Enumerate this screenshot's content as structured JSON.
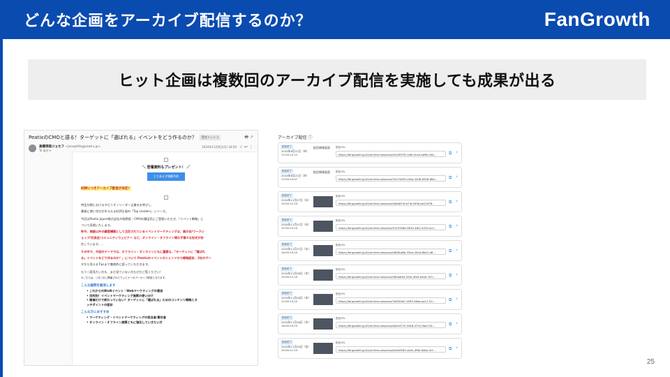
{
  "header": {
    "title": "どんな企画をアーカイブ配信するのか？",
    "logo": "FanGrowth"
  },
  "banner": {
    "text": "ヒット企画は複数回のアーカイブ配信を実施しても成果が出る"
  },
  "page_number": "25",
  "email": {
    "subject": "PeatixのCMOと語る！ターゲットに「選ばれる」イベントをどう作るのか？",
    "tag": "受信トレイ ×",
    "actions": "🖶 ↗",
    "sender_name": "高橋現哉ジョセフ",
    "sender_email": "<josephtk@peatix.jp>",
    "to": "To 自分 ▾",
    "date": "2024年11月8日(月) 18:20",
    "icons": "☆ ↩ ⋮",
    "present": "＼ 登壇資料もプレゼント！ ／",
    "button": "とりあえず視聴予約",
    "highlight": "好評につきアーカイブ配信が決定！",
    "paragraphs": [
      "特定分野におけるオピニオンリーダー企業をお呼びし、",
      "業務に使い学び方を与える好評企画の「Top Leaders」シリーズ。",
      "今回はPeatix Japan株式会社の取締役・CMOの藤田氏にご登壇いただき、「イベント戦略」に",
      "ついて深堀いたします。",
      "昨今、商談以外の顧客構築として注目されているイベントマーケティングは、展示会/ワークシ",
      "ョップ/交流会/コミュニティウェビナー など、オンライン・オフライン問わず様々な形式が存",
      "在しています。…",
      "その中で、今回のテーマでは、オフライン・オンラインともに重要な、「ターゲットに「選ばれ",
      "る」イベントをどう作るのか？」について Peatixのイベントのトレンドから戦略設計、2社のデー",
      "タから見えるTipsまで徹底的に語っていただきます。",
      "もう一度見たい方も、まだ見ていない方もぜひご覧ください！"
    ],
    "note": "※こちらは、○月○日に開催されたウェビナーのアーカイブ配信となります。",
    "sec1": "こんな疑問を解消します",
    "bullets1": [
      "これからのBtoBイベント・Webマーケティングの潮流",
      "目的別！イベントマーケティング施策の使い分け",
      "開催だけで終わっていない？ターゲットに「選ばれる」ためのコンテンツ戦略とタ",
      "ッチポイントの設計"
    ],
    "sec2": "こんな方におすすめ",
    "bullets2": [
      "マーケティング・イベントマーケティングの担当者/責任者",
      "オンライン・オフライン施策ともに強化していきたい方"
    ]
  },
  "archive": {
    "title": "アーカイブ配信 ⓘ",
    "url_label": "配信URL",
    "rows": [
      {
        "badge": "配信終了",
        "date": "2024年8月22日（木）",
        "time": "11:05:12:12",
        "thumb": "配信情報画面",
        "url": "https://fangrowth.jp/v2/archive-sessions/d1e30978-1dfe-4ca4-be6b-44e..."
      },
      {
        "badge": "配信終了",
        "date": "2024年8月22日（木）",
        "time": "13:00:14:07",
        "thumb": "配信情報画面",
        "url": "https://fangrowth.jp/v2/archive-sessions/32e74d20-c9ea-42d6-8348-88e..."
      },
      {
        "badge": "配信終了",
        "date": "2024年11月27日（水）",
        "time": "10:00:11:10",
        "thumb": "",
        "url": "https://fangrowth.jp/v2/archive-sessions/4dba674f-a74f-493b-be21678..."
      },
      {
        "badge": "配信終了",
        "date": "2024年11月27日（水）",
        "time": "12:00:13:10",
        "thumb": "",
        "url": "https://fangrowth.jp/v2/archive-sessions/5103308d-9630-4fb1-b334-ec1..."
      },
      {
        "badge": "配信終了",
        "date": "2024年11月27日（水）",
        "time": "16:00:19:10",
        "thumb": "",
        "url": "https://fangrowth.jp/v2/archive-sessions/a608ca8b-33ea-40d4-8b42-d6..."
      },
      {
        "badge": "配信終了",
        "date": "2024年11月28日（木）",
        "time": "10:00:11:10",
        "thumb": "",
        "url": "https://fangrowth.jp/v2/archive-sessions/080aafa5-03f4-4fa9-b44d-7d3..."
      },
      {
        "badge": "配信終了",
        "date": "2024年11月28日（木）",
        "time": "12:00:13:10",
        "thumb": "",
        "url": "https://fangrowth.jp/v2/archive-sessions/7b55f4d2-1693-48da-aa17-20..."
      },
      {
        "badge": "配信終了",
        "date": "2024年11月28日（木）",
        "time": "16:00:19:10",
        "thumb": "",
        "url": "https://fangrowth.jp/v2/archive-sessions/da2e4715-58c8-47c0-9aa7-81..."
      },
      {
        "badge": "配信終了",
        "date": "2024年11月29日（金）",
        "time": "10:00:11:10",
        "thumb": "",
        "url": "https://fangrowth.jp/v2/archive-sessions/b2ba9583-cbd1-4f6e-84be-5cf..."
      }
    ]
  }
}
